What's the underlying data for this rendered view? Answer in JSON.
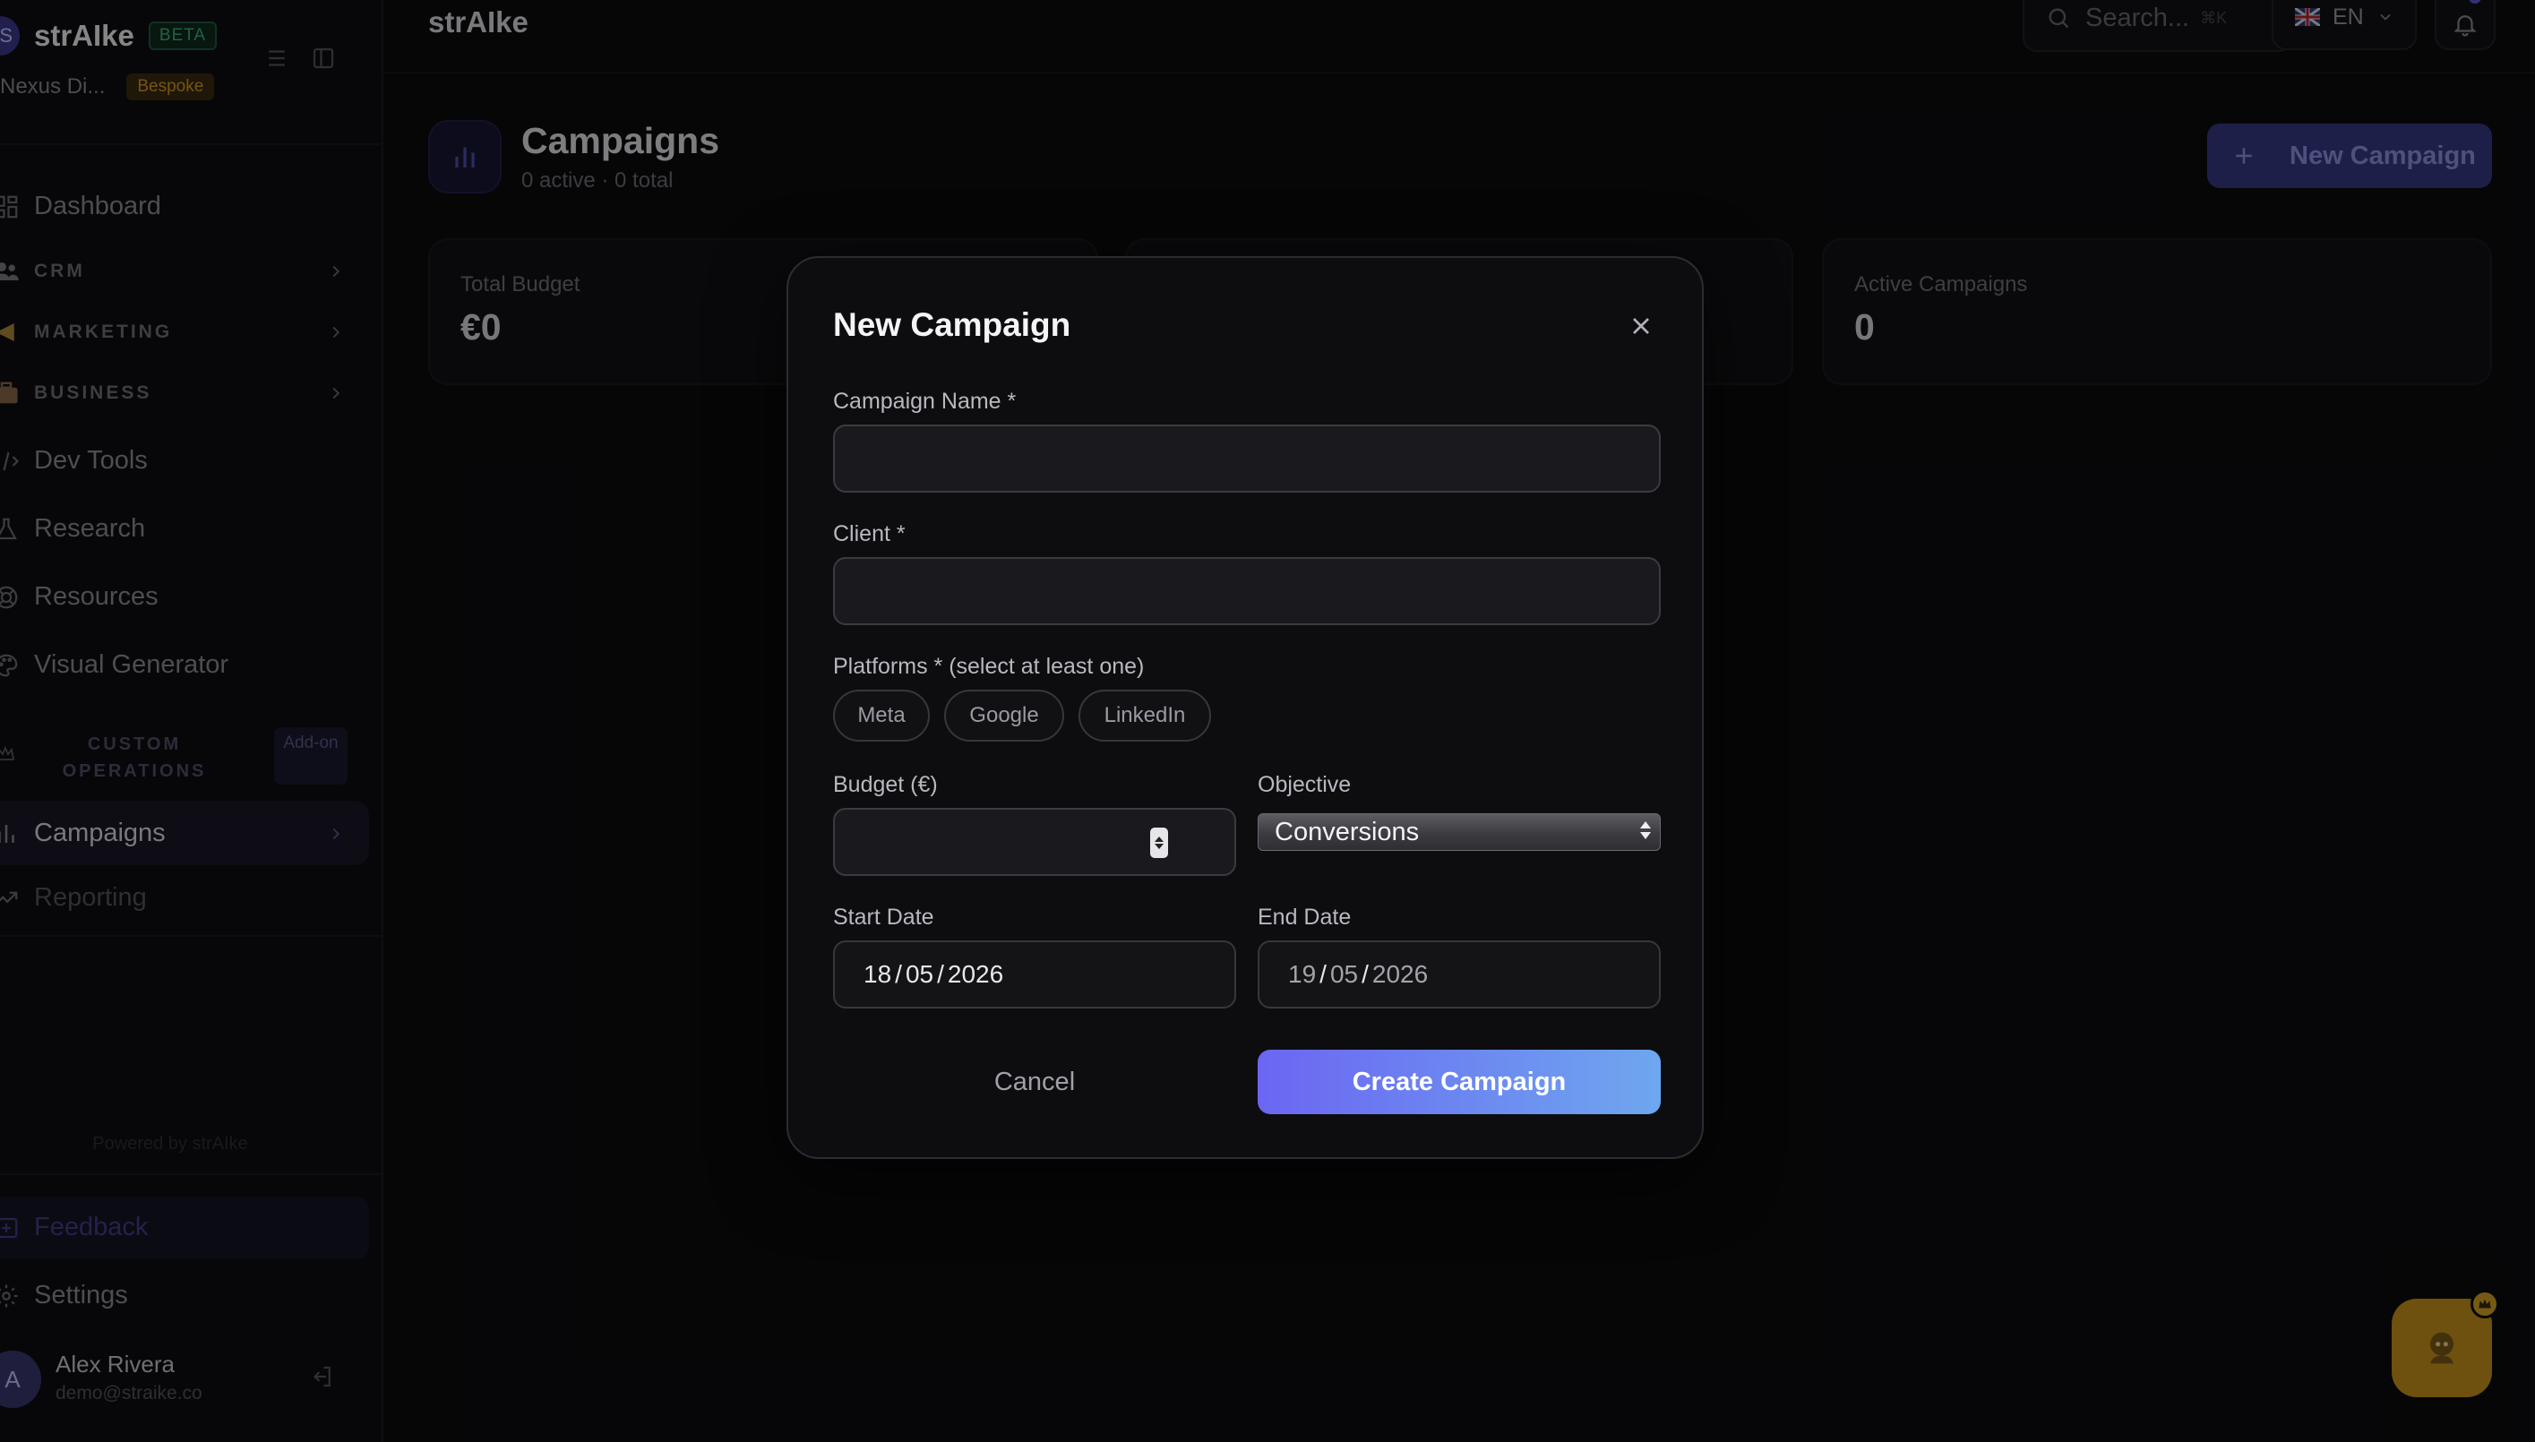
{
  "app": {
    "brand_initial": "S",
    "brand_name": "strAIke",
    "beta_badge": "BETA",
    "org_name": "Nexus Di...",
    "org_badge": "Bespoke",
    "powered_by": "Powered by strAIke"
  },
  "sidebar": {
    "items": [
      {
        "label": "Dashboard",
        "icon": "dashboard-icon"
      },
      {
        "label": "CRM",
        "icon": "users-icon",
        "section": true
      },
      {
        "label": "MARKETING",
        "icon": "megaphone-icon",
        "section": true
      },
      {
        "label": "BUSINESS",
        "icon": "briefcase-icon",
        "section": true
      },
      {
        "label": "Dev Tools",
        "icon": "code-icon"
      },
      {
        "label": "Research",
        "icon": "flask-icon"
      },
      {
        "label": "Resources",
        "icon": "lifebuoy-icon"
      },
      {
        "label": "Visual Generator",
        "icon": "palette-icon"
      }
    ],
    "custom_ops_label": "CUSTOM OPERATIONS",
    "addon_badge": "Add-on",
    "active_item": "Campaigns",
    "reporting": "Reporting",
    "feedback": "Feedback",
    "settings": "Settings",
    "user": {
      "initial": "A",
      "name": "Alex Rivera",
      "email": "demo@straike.co"
    }
  },
  "topbar": {
    "title": "strAIke",
    "search_placeholder": "Search...",
    "search_shortcut": "⌘K",
    "language": "EN"
  },
  "page": {
    "title": "Campaigns",
    "subtitle": "0 active · 0 total",
    "new_button": "New Campaign"
  },
  "stats": [
    {
      "label": "Total Budget",
      "value": "€0"
    },
    {
      "label": "Active Campaigns",
      "value": "0"
    }
  ],
  "modal": {
    "title": "New Campaign",
    "campaign_name_label": "Campaign Name *",
    "campaign_name_value": "",
    "client_label": "Client *",
    "client_value": "",
    "platforms_label": "Platforms * (select at least one)",
    "platforms": [
      "Meta",
      "Google",
      "LinkedIn"
    ],
    "budget_label": "Budget (€)",
    "budget_value": "",
    "objective_label": "Objective",
    "objective_value": "Conversions",
    "start_date_label": "Start Date",
    "start_date": {
      "day": "18",
      "month": "05",
      "year": "2026"
    },
    "end_date_label": "End Date",
    "end_date": {
      "day": "19",
      "month": "05",
      "year": "2026"
    },
    "cancel_label": "Cancel",
    "create_label": "Create Campaign"
  },
  "colors": {
    "background": "#0b0b0e",
    "accent": "#6b66f2",
    "accent_end": "#6ea7ef",
    "beta_green": "#3fb37a",
    "bespoke_amber": "#d79a2b",
    "fab": "#c9921c"
  }
}
